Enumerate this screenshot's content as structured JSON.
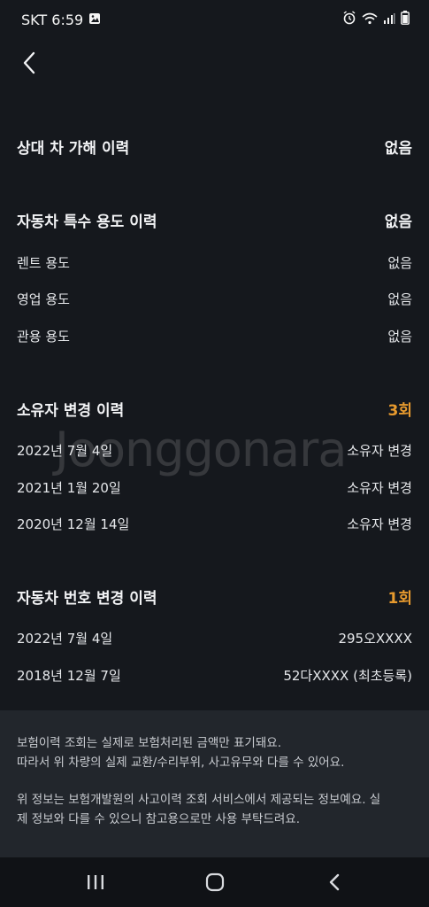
{
  "status": {
    "carrier_time": "SKT 6:59"
  },
  "sections": {
    "opponent": {
      "title": "상대 차 가해 이력",
      "value": "없음"
    },
    "special_use": {
      "title": "자동차 특수 용도 이력",
      "value": "없음",
      "items": [
        {
          "label": "렌트 용도",
          "value": "없음"
        },
        {
          "label": "영업 용도",
          "value": "없음"
        },
        {
          "label": "관용 용도",
          "value": "없음"
        }
      ]
    },
    "owner_change": {
      "title": "소유자 변경 이력",
      "value": "3회",
      "items": [
        {
          "label": "2022년 7월 4일",
          "value": "소유자 변경"
        },
        {
          "label": "2021년 1월 20일",
          "value": "소유자 변경"
        },
        {
          "label": "2020년 12월 14일",
          "value": "소유자 변경"
        }
      ]
    },
    "plate_change": {
      "title": "자동차 번호 변경 이력",
      "value": "1회",
      "items": [
        {
          "label": "2022년 7월 4일",
          "value": "295오XXXX"
        },
        {
          "label": "2018년 12월 7일",
          "value": "52다XXXX (최초등록)"
        }
      ]
    }
  },
  "watermark": "Joonggonara",
  "notice": {
    "p1_line1": "보험이력 조회는 실제로 보험처리된 금액만 표기돼요.",
    "p1_line2": "따라서 위 차량의 실제 교환/수리부위, 사고유무와 다를 수 있어요.",
    "p2_line1": "위 정보는 보험개발원의 사고이력 조회 서비스에서 제공되는 정보예요. 실",
    "p2_line2": "제 정보와 다를 수 있으니 참고용으로만 사용 부탁드려요."
  },
  "colors": {
    "accent": "#e79a2e",
    "background": "#15181d",
    "panel": "#22262c"
  },
  "icons": [
    "gallery-icon",
    "alarm-icon",
    "wifi-icon",
    "signal-icon",
    "battery-icon",
    "back-chevron-icon",
    "recents-icon",
    "home-icon",
    "nav-back-icon"
  ]
}
